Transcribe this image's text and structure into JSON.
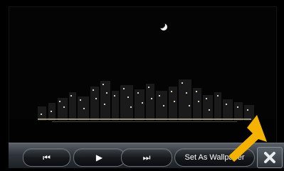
{
  "viewer": {
    "image_subject": "night city skyline with crescent moon"
  },
  "controls": {
    "prev_icon": "skip-previous-icon",
    "prev_glyph": "⏮",
    "play_icon": "play-icon",
    "play_glyph": "▶",
    "next_icon": "skip-next-icon",
    "next_glyph": "⏭",
    "wallpaper_label": "Set As Wallpaper",
    "close_icon": "close-icon"
  },
  "colors": {
    "toolbar": "#30353b",
    "pointer_arrow": "#f5b300"
  }
}
